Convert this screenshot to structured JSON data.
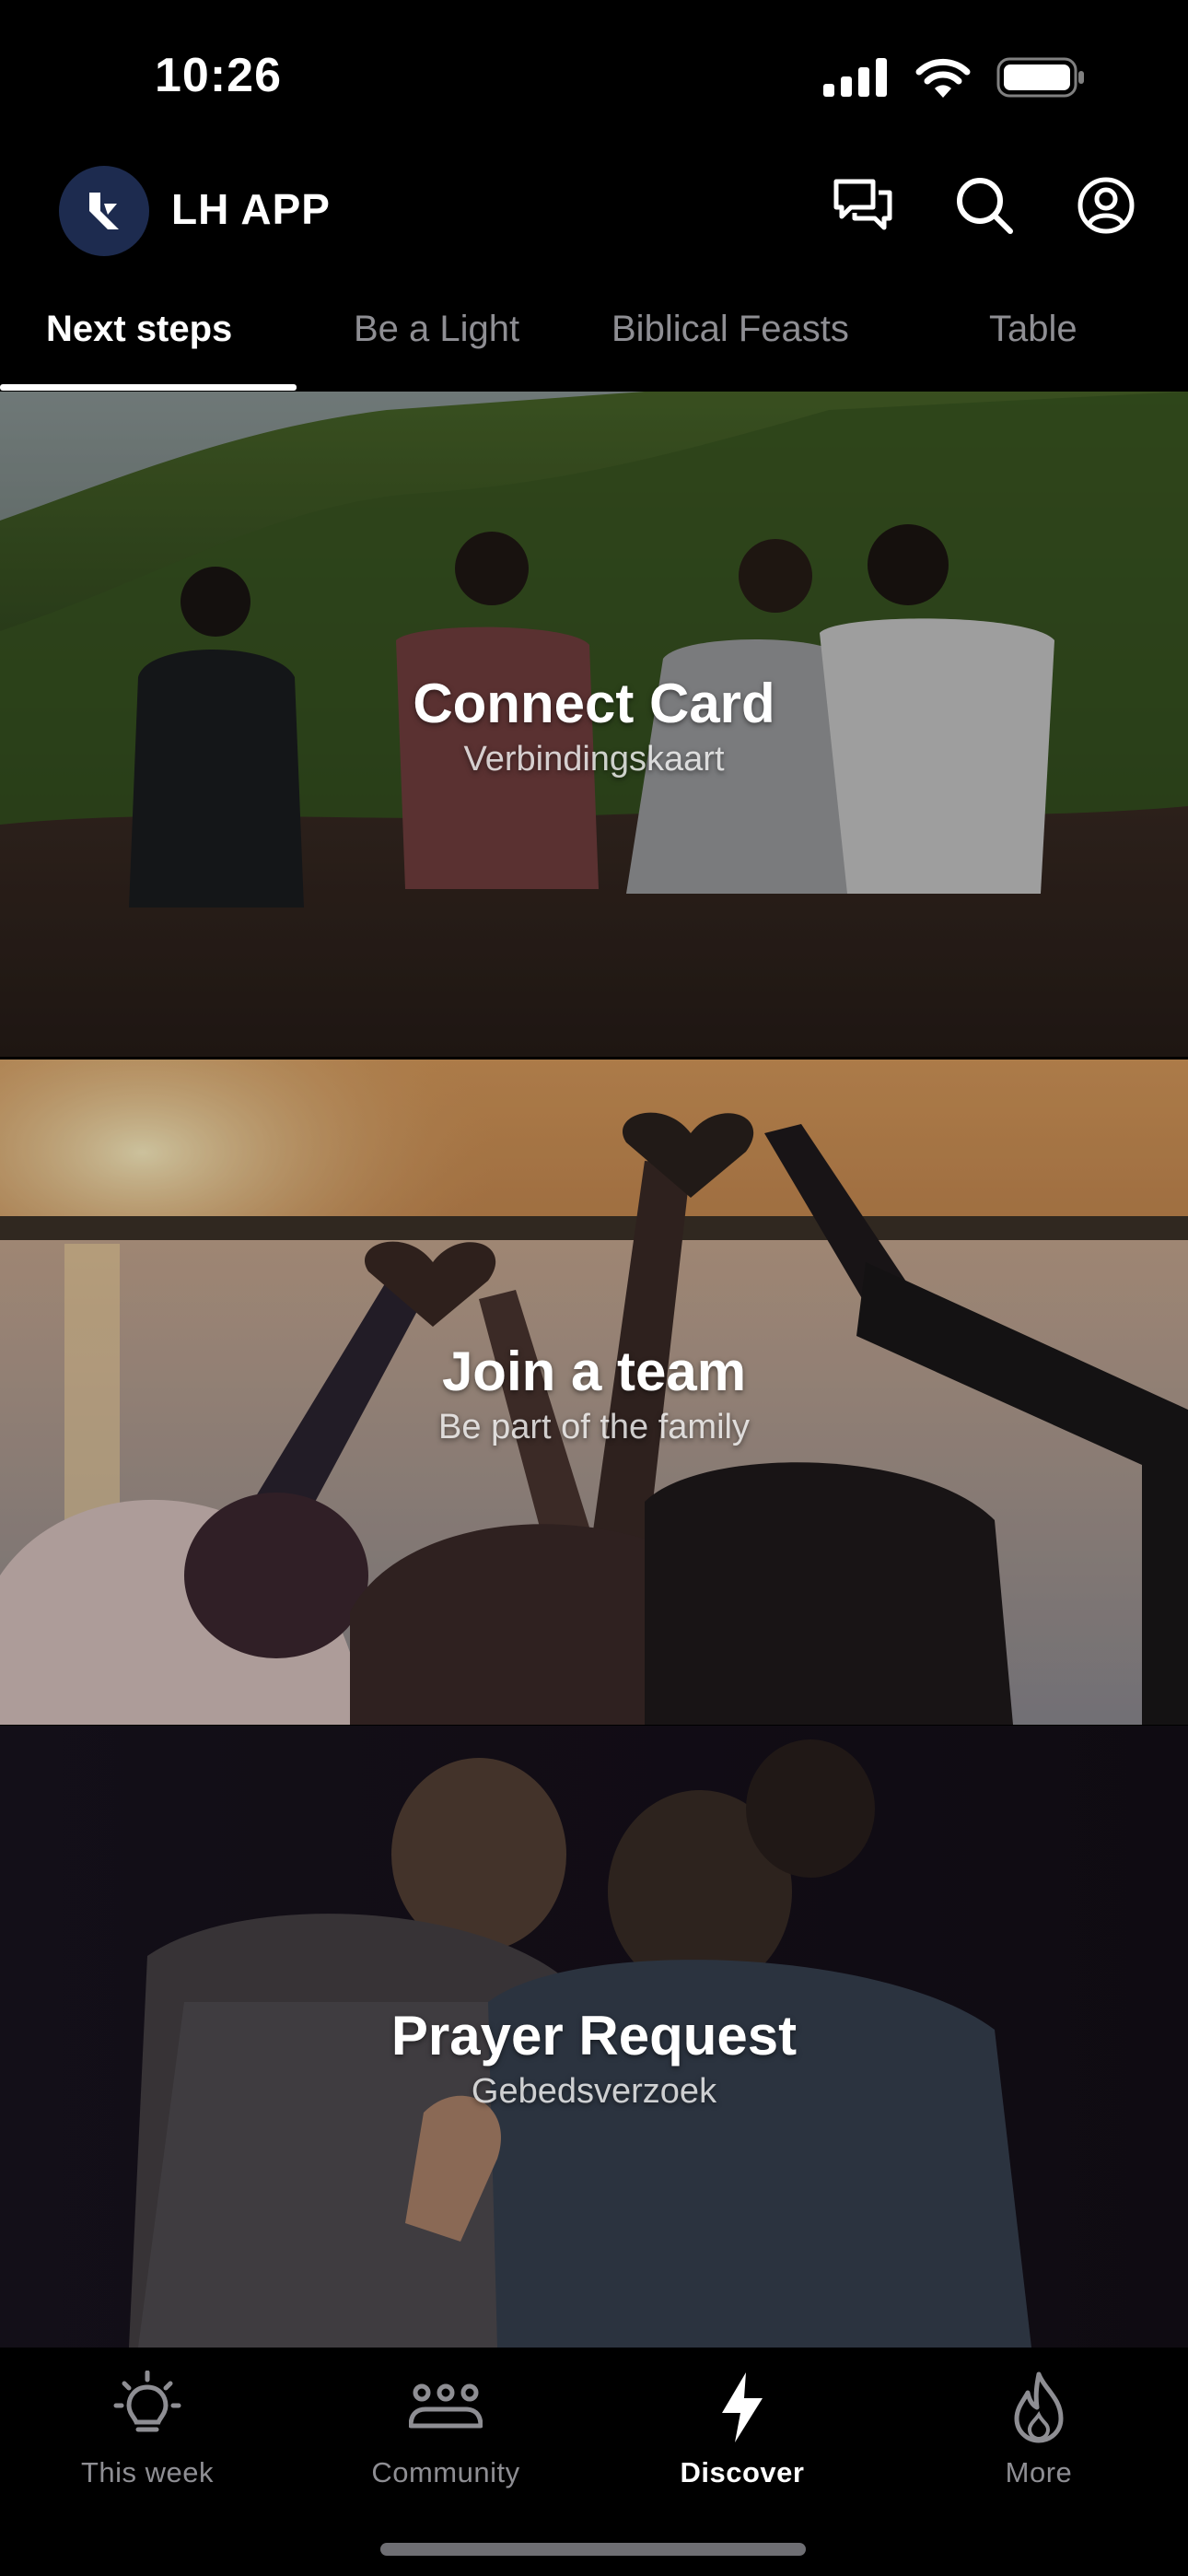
{
  "status_bar": {
    "time": "10:26"
  },
  "header": {
    "title": "LH APP"
  },
  "tabs": [
    {
      "label": "Next steps",
      "active": true
    },
    {
      "label": "Be a Light",
      "active": false
    },
    {
      "label": "Biblical Feasts",
      "active": false
    },
    {
      "label": "Table",
      "active": false
    }
  ],
  "cards": [
    {
      "title": "Connect Card",
      "subtitle": "Verbindingskaart"
    },
    {
      "title": "Join a team",
      "subtitle": "Be part of the family"
    },
    {
      "title": "Prayer Request",
      "subtitle": "Gebedsverzoek"
    }
  ],
  "bottom_nav": [
    {
      "label": "This week",
      "icon": "lightbulb-icon",
      "active": false
    },
    {
      "label": "Community",
      "icon": "people-icon",
      "active": false
    },
    {
      "label": "Discover",
      "icon": "lightning-icon",
      "active": true
    },
    {
      "label": "More",
      "icon": "flame-icon",
      "active": false
    }
  ],
  "colors": {
    "background": "#000000",
    "active_text": "#ffffff",
    "inactive_text": "#8e8e93",
    "logo_bg": "#1d2b4f"
  }
}
